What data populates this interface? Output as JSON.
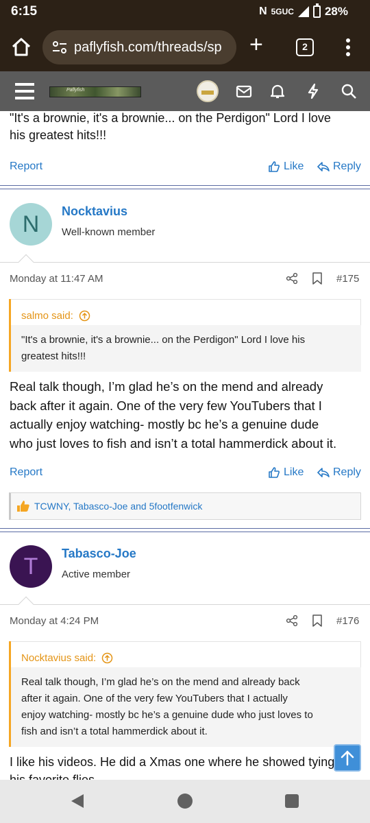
{
  "status_bar": {
    "time": "6:15",
    "network": "5GUC",
    "battery": "28%"
  },
  "browser": {
    "url": "paflyfish.com/threads/sp",
    "tab_count": "2",
    "new_tab_icon": "+"
  },
  "site_header": {
    "logo_text": "Paflyfish"
  },
  "posts": {
    "prev_tail": {
      "lines": [
        "\"It's a brownie, it's a brownie... on the Perdigon\" Lord I love",
        "his greatest hits!!!"
      ],
      "report": "Report",
      "like": "Like",
      "reply": "Reply"
    },
    "post175": {
      "avatar_letter": "N",
      "avatar_color": "#a6d6d6",
      "avatar_text_color": "#2d6d6d",
      "name": "Nocktavius",
      "title": "Well-known member",
      "date": "Monday at 11:47 AM",
      "number": "#175",
      "quote_author": "salmo said:",
      "quote_lines": [
        "\"It's a brownie, it's a brownie... on the Perdigon\" Lord I love his",
        "greatest hits!!!"
      ],
      "body_lines": [
        "Real talk though, I’m glad he’s on the mend and already",
        "back after it again. One of the very few YouTubers that I",
        "actually enjoy watching- mostly bc he’s a genuine dude",
        "who just loves to fish and isn’t a total hammerdick about it."
      ],
      "report": "Report",
      "like": "Like",
      "reply": "Reply",
      "reactions": "TCWNY, Tabasco-Joe and 5footfenwick"
    },
    "post176": {
      "avatar_letter": "T",
      "avatar_color": "#3a1452",
      "avatar_text_color": "#b07cd6",
      "name": "Tabasco-Joe",
      "title": "Active member",
      "date": "Monday at 4:24 PM",
      "number": "#176",
      "quote_author": "Nocktavius said:",
      "quote_lines": [
        "Real talk though, I’m glad he’s on the mend and already back",
        "after it again. One of the very few YouTubers that I actually",
        "enjoy watching- mostly bc he’s a genuine dude who just loves to",
        "fish and isn’t a total hammerdick about it."
      ],
      "body_lines": [
        "I like his videos. He did a Xmas one where he showed tying",
        "his favorite flies"
      ]
    }
  },
  "colors": {
    "link": "#2578c6",
    "quote_accent": "#f5a623",
    "header_bg": "#5b5b5b",
    "browser_bg": "#2c2116"
  },
  "icons": [
    "home-icon",
    "site-settings-icon",
    "menu-icon",
    "messages-icon",
    "bell-icon",
    "bolt-icon",
    "search-icon",
    "thumbs-up-icon",
    "reply-icon",
    "share-icon",
    "bookmark-icon",
    "arrow-up-circle-icon",
    "like-reaction-icon",
    "arrow-up-icon"
  ]
}
